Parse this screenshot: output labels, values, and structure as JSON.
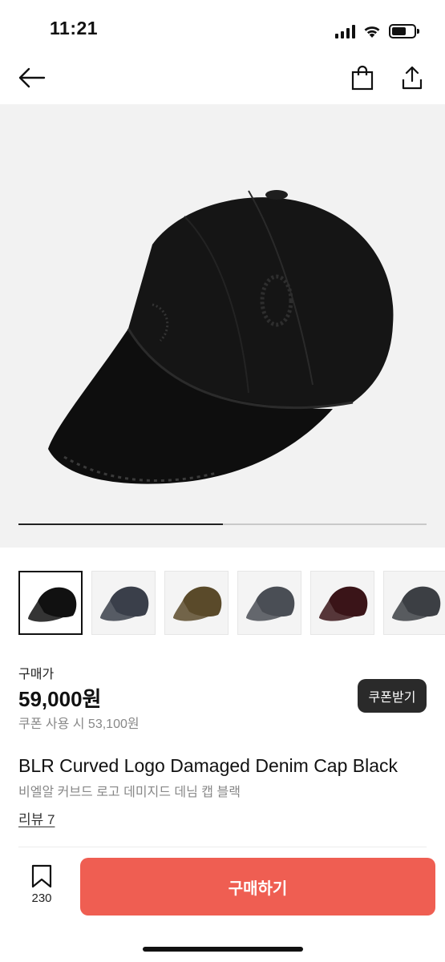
{
  "status_bar": {
    "time": "11:21"
  },
  "nav": {
    "back_icon": "arrow-left-icon",
    "bag_icon": "shopping-bag-icon",
    "share_icon": "share-icon"
  },
  "gallery": {
    "image_count": 2,
    "current_index": 1,
    "progress": 0.5,
    "thumbnails": [
      {
        "name": "black-cap",
        "color": "#111111"
      },
      {
        "name": "denim-patch-cap",
        "color": "#3a3f4a"
      },
      {
        "name": "brown-camo-cap",
        "color": "#5a4a2a"
      },
      {
        "name": "gray-denim-cap",
        "color": "#4a4e55"
      },
      {
        "name": "burgundy-cap",
        "color": "#3a1418"
      },
      {
        "name": "charcoal-cap",
        "color": "#3c3f44"
      }
    ]
  },
  "price": {
    "label": "구매가",
    "amount": "59,000원",
    "coupon_text": "쿠폰 사용 시 53,100원",
    "coupon_button": "쿠폰받기"
  },
  "product": {
    "title_en": "BLR Curved Logo Damaged Denim Cap Black",
    "title_ko": "비엘알 커브드 로고 데미지드 데님 캡 블랙",
    "review_link": "리뷰 7"
  },
  "bottom_bar": {
    "bookmark_count": "230",
    "buy_button": "구매하기"
  },
  "colors": {
    "accent": "#EF5E52",
    "dark_button": "#2A2A2A",
    "hero_bg": "#F2F2F2"
  }
}
